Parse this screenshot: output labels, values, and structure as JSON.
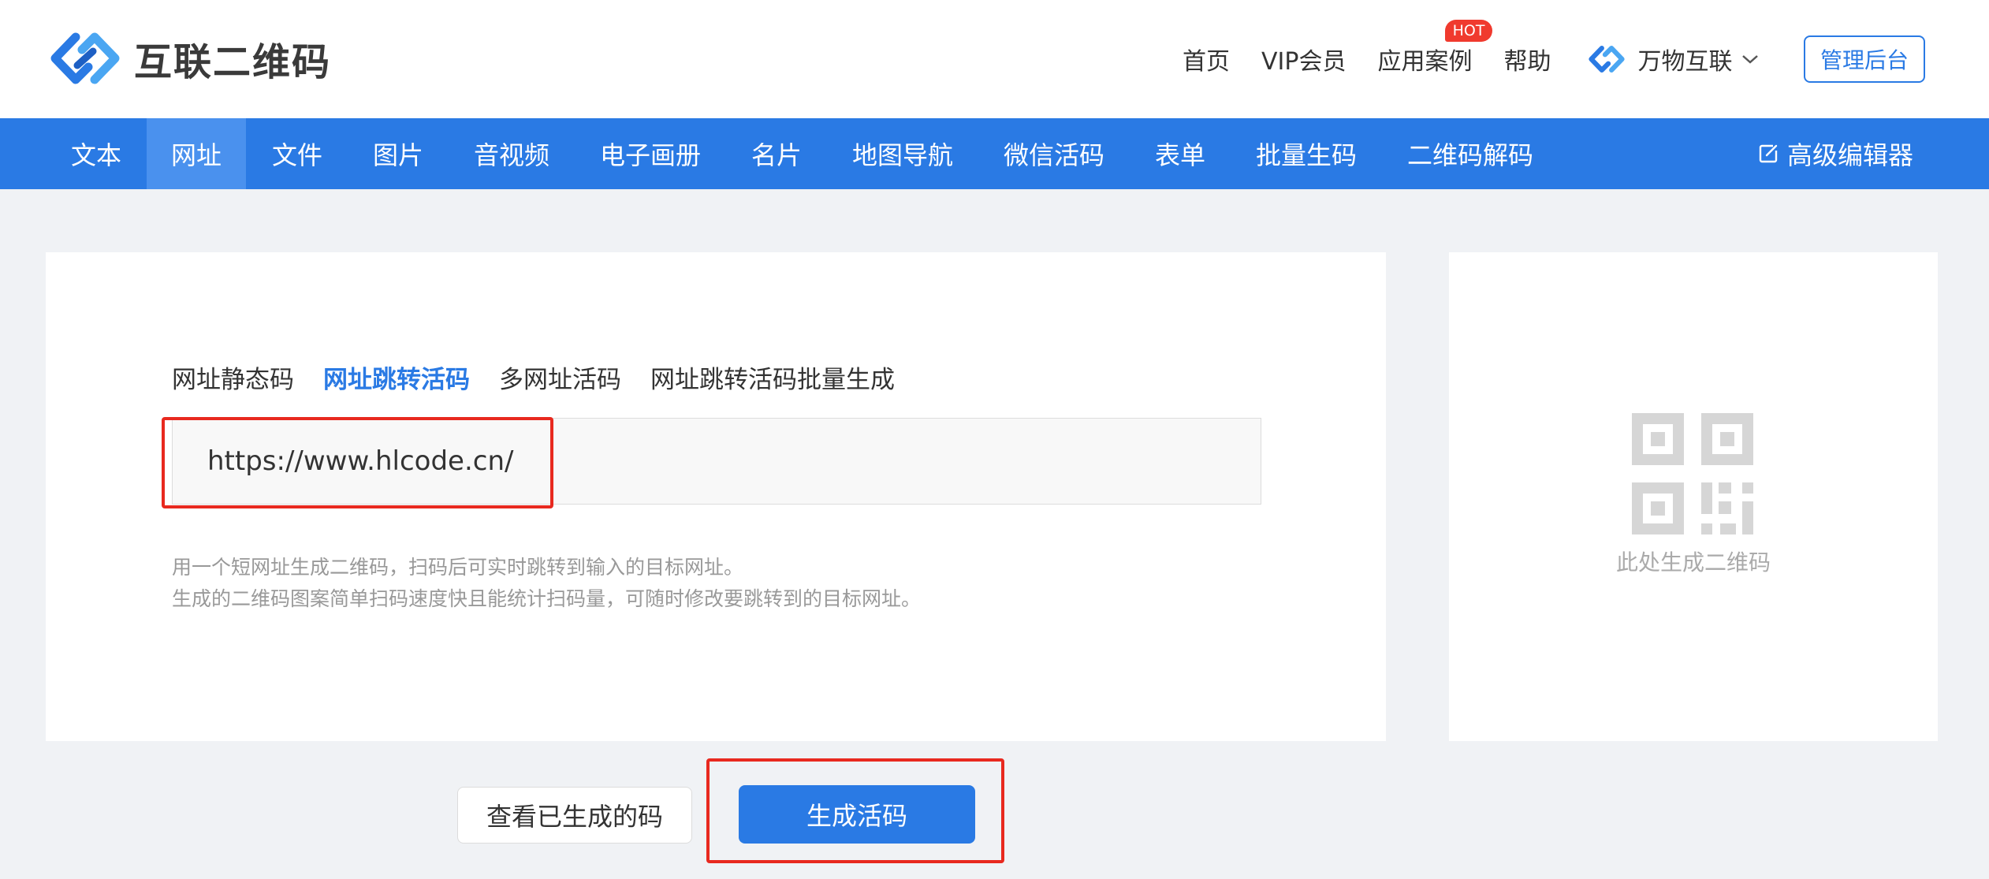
{
  "header": {
    "logo_text": "互联二维码",
    "nav": {
      "home": "首页",
      "vip": "VIP会员",
      "cases": "应用案例",
      "hot_badge": "HOT",
      "help": "帮助",
      "brand_menu": "万物互联"
    },
    "admin_button": "管理后台"
  },
  "mainnav": {
    "items": [
      "文本",
      "网址",
      "文件",
      "图片",
      "音视频",
      "电子画册",
      "名片",
      "地图导航",
      "微信活码",
      "表单",
      "批量生码",
      "二维码解码"
    ],
    "active_index": 1,
    "advanced_editor": "高级编辑器"
  },
  "form": {
    "tabs": [
      "网址静态码",
      "网址跳转活码",
      "多网址活码",
      "网址跳转活码批量生成"
    ],
    "active_tab_index": 1,
    "url_value": "https://www.hlcode.cn/",
    "desc_line1": "用一个短网址生成二维码，扫码后可实时跳转到输入的目标网址。",
    "desc_line2": "生成的二维码图案简单扫码速度快且能统计扫码量，可随时修改要跳转到的目标网址。"
  },
  "preview": {
    "placeholder_text": "此处生成二维码"
  },
  "actions": {
    "view_generated": "查看已生成的码",
    "generate": "生成活码"
  },
  "colors": {
    "primary": "#2a7ae4",
    "highlight_box": "#e8291f",
    "hot_badge": "#f03a2e"
  }
}
